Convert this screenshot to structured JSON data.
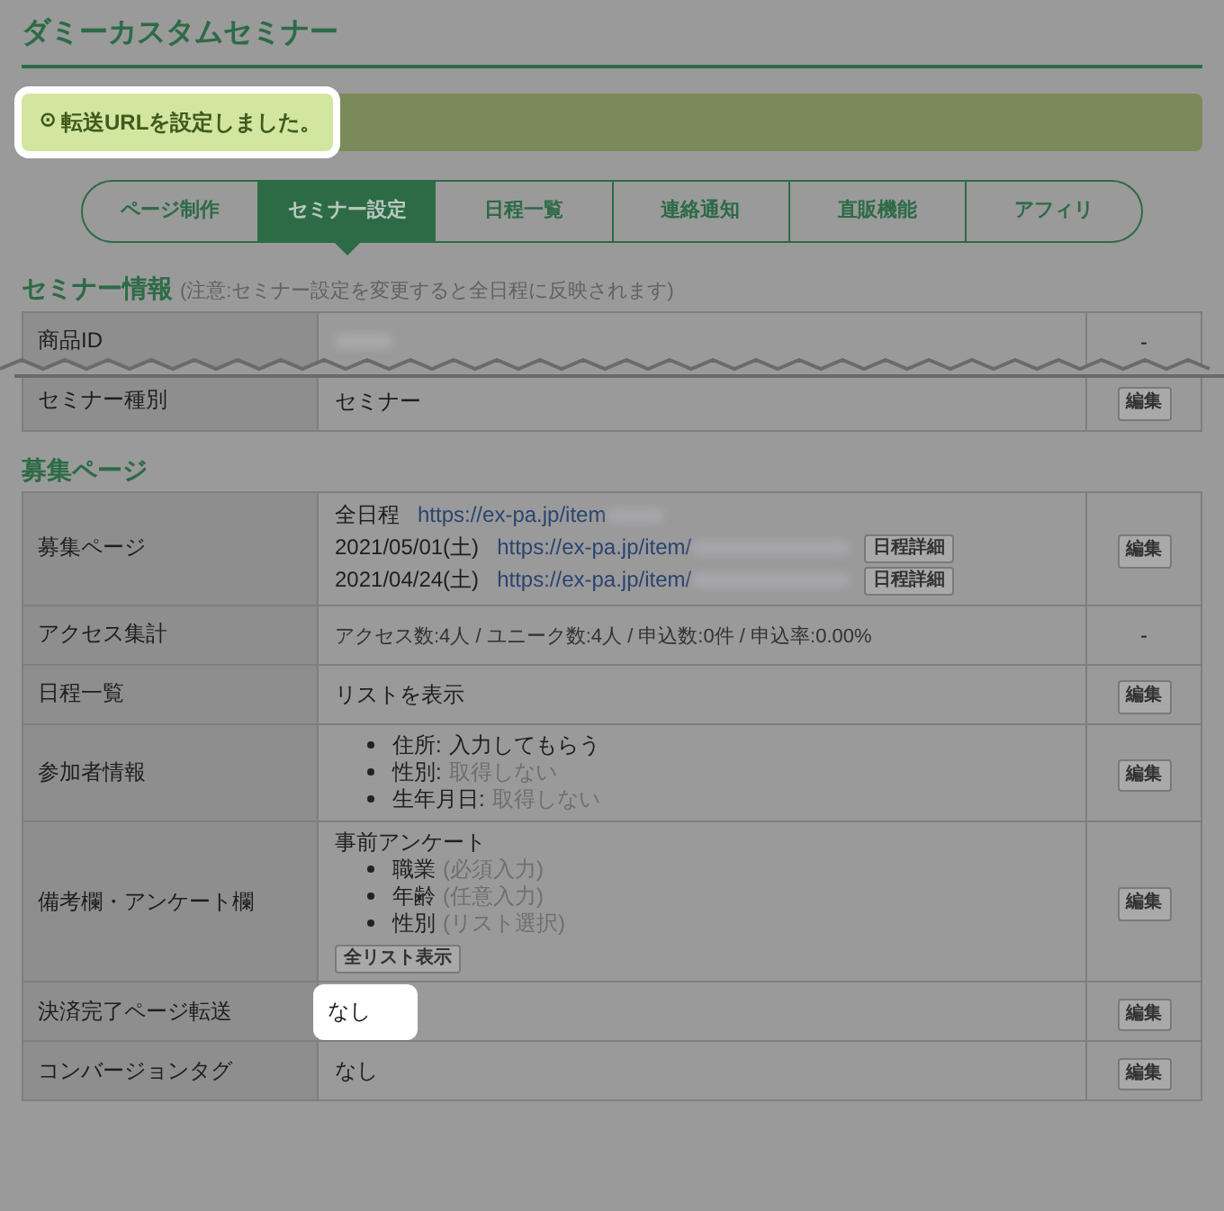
{
  "page_title": "ダミーカスタムセミナー",
  "alert": {
    "icon": "⊙",
    "text": "転送URLを設定しました。",
    "highlighted": true
  },
  "tabs": [
    {
      "label": "ページ制作",
      "selected": false
    },
    {
      "label": "セミナー設定",
      "selected": true
    },
    {
      "label": "日程一覧",
      "selected": false
    },
    {
      "label": "連絡通知",
      "selected": false
    },
    {
      "label": "直販機能",
      "selected": false
    },
    {
      "label": "アフィリ",
      "selected": false
    }
  ],
  "seminar_info": {
    "heading": "セミナー情報",
    "note": "(注意:セミナー設定を変更すると全日程に反映されます)",
    "rows": [
      {
        "label": "商品ID",
        "kind": "redacted",
        "action": {
          "kind": "text",
          "label": "-"
        }
      },
      {
        "label": "セミナー種別",
        "kind": "text",
        "value": "セミナー",
        "action": {
          "kind": "button",
          "label": "編集"
        }
      }
    ]
  },
  "recruit": {
    "heading": "募集ページ",
    "rows": [
      {
        "label": "募集ページ",
        "kind": "links",
        "links": [
          {
            "date": "全日程",
            "url": "https://ex-pa.jp/item"
          },
          {
            "date": "2021/05/01(土)",
            "url": "https://ex-pa.jp/item/",
            "button": "日程詳細"
          },
          {
            "date": "2021/04/24(土)",
            "url": "https://ex-pa.jp/item/",
            "button": "日程詳細"
          }
        ],
        "action": {
          "kind": "button",
          "label": "編集"
        }
      },
      {
        "label": "アクセス集計",
        "kind": "small",
        "value": "アクセス数:4人 / ユニーク数:4人 / 申込数:0件 / 申込率:0.00%",
        "action": {
          "kind": "text",
          "label": "-"
        }
      },
      {
        "label": "日程一覧",
        "kind": "text",
        "value": "リストを表示",
        "action": {
          "kind": "button",
          "label": "編集"
        }
      },
      {
        "label": "参加者情報",
        "kind": "list",
        "items": [
          {
            "name": "住所:",
            "value": "入力してもらう",
            "muted": false
          },
          {
            "name": "性別:",
            "value": "取得しない",
            "muted": true
          },
          {
            "name": "生年月日:",
            "value": "取得しない",
            "muted": true
          }
        ],
        "action": {
          "kind": "button",
          "label": "編集"
        }
      },
      {
        "label": "備考欄・アンケート欄",
        "kind": "survey",
        "title": "事前アンケート",
        "items": [
          {
            "name": "職業",
            "value": "(必須入力)",
            "muted": true
          },
          {
            "name": "年齢",
            "value": "(任意入力)",
            "muted": true
          },
          {
            "name": "性別",
            "value": "(リスト選択)",
            "muted": true
          }
        ],
        "button": "全リスト表示",
        "action": {
          "kind": "button",
          "label": "編集"
        }
      },
      {
        "label": "決済完了ページ転送",
        "kind": "text",
        "value": "なし",
        "highlighted": true,
        "action": {
          "kind": "button",
          "label": "編集"
        }
      },
      {
        "label": "コンバージョンタグ",
        "kind": "text",
        "value": "なし",
        "action": {
          "kind": "button",
          "label": "編集"
        }
      }
    ]
  }
}
